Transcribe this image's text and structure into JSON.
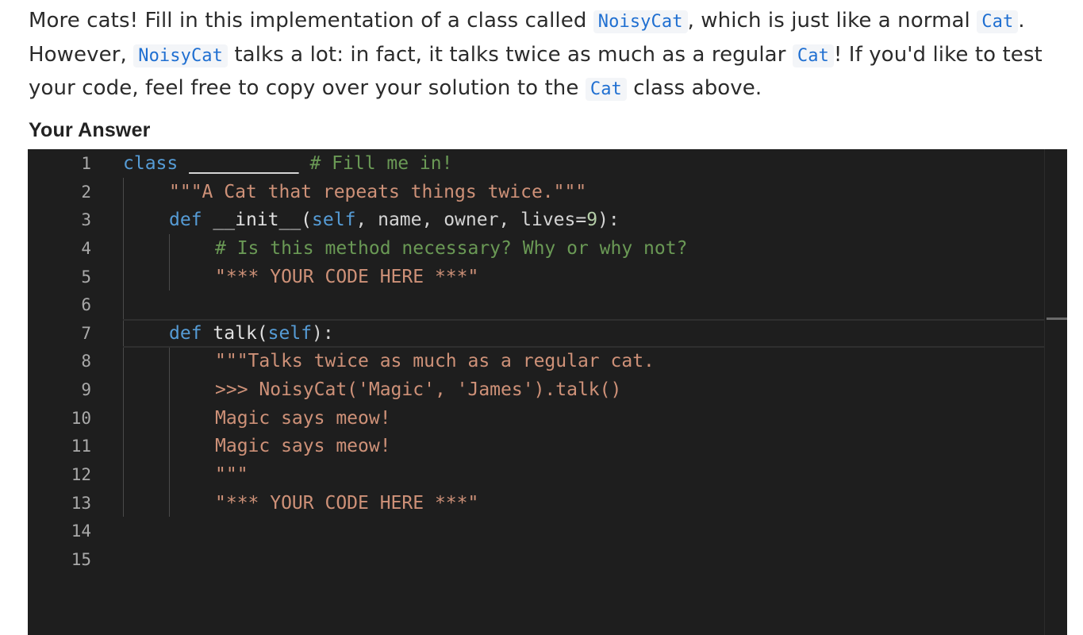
{
  "prompt": {
    "t1": "More cats! Fill in this implementation of a class called ",
    "c1": "NoisyCat",
    "t2": ", which is just like a normal ",
    "c2": "Cat",
    "t3": ". However, ",
    "c3": "NoisyCat",
    "t4": " talks a lot: in fact, it talks twice as much as a regular ",
    "c4": "Cat",
    "t5": "! If you'd like to test your code, feel free to copy over your solution to the ",
    "c5": "Cat",
    "t6": " class above."
  },
  "answer_heading": "Your Answer",
  "editor": {
    "line_numbers": [
      "1",
      "2",
      "3",
      "4",
      "5",
      "6",
      "7",
      "8",
      "9",
      "10",
      "11",
      "12",
      "13",
      "14",
      "15"
    ],
    "code": {
      "l1_kw": "class",
      "l1_blank": "__________",
      "l1_comment": "# Fill me in!",
      "l2": "\"\"\"A Cat that repeats things twice.\"\"\"",
      "l3_kw": "def",
      "l3_name": "__init__(",
      "l3_self": "self",
      "l3_rest": ", name, owner, lives=",
      "l3_num": "9",
      "l3_end": "):",
      "l4": "# Is this method necessary? Why or why not?",
      "l5": "\"*** YOUR CODE HERE ***\"",
      "l7_kw": "def",
      "l7_name": "talk(",
      "l7_self": "self",
      "l7_end": "):",
      "l8": "\"\"\"Talks twice as much as a regular cat.",
      "l9": ">>> NoisyCat('Magic', 'James').talk()",
      "l10": "Magic says meow!",
      "l11": "Magic says meow!",
      "l12": "\"\"\"",
      "l13": "\"*** YOUR CODE HERE ***\""
    }
  }
}
